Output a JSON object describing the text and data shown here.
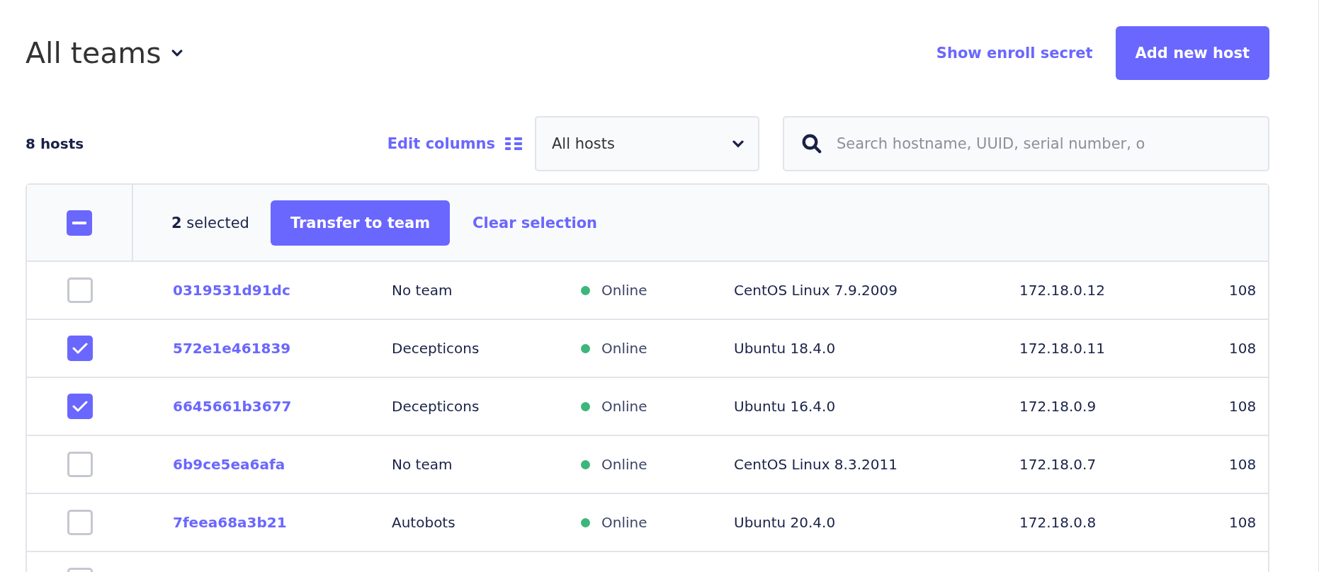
{
  "header": {
    "title": "All teams",
    "show_enroll_secret": "Show enroll secret",
    "add_button": "Add new host"
  },
  "toolbar": {
    "count": "8 hosts",
    "edit_columns": "Edit columns",
    "filter": {
      "value": "All hosts"
    },
    "search": {
      "placeholder": "Search hostname, UUID, serial number, o"
    }
  },
  "selection_bar": {
    "select_all": {
      "indeterminate": true
    },
    "selected_text": "**2** selected",
    "transfer_button": "Transfer to team",
    "clear_link": "Clear selection"
  },
  "table": {
    "rows": [
      {
        "checked": false,
        "hostname": "0319531d91dc",
        "team": "No team",
        "status": "Online",
        "os": "CentOS Linux 7.9.2009",
        "ip": "172.18.0.12",
        "column_7": "108"
      },
      {
        "checked": true,
        "hostname": "572e1e461839",
        "team": "Decepticons",
        "status": "Online",
        "os": "Ubuntu 18.4.0",
        "ip": "172.18.0.11",
        "column_7": "108"
      },
      {
        "checked": true,
        "hostname": "6645661b3677",
        "team": "Decepticons",
        "status": "Online",
        "os": "Ubuntu 16.4.0",
        "ip": "172.18.0.9",
        "column_7": "108"
      },
      {
        "checked": false,
        "hostname": "6b9ce5ea6afa",
        "team": "No team",
        "status": "Online",
        "os": "CentOS Linux 8.3.2011",
        "ip": "172.18.0.7",
        "column_7": "108"
      },
      {
        "checked": false,
        "hostname": "7feea68a3b21",
        "team": "Autobots",
        "status": "Online",
        "os": "Ubuntu 20.4.0",
        "ip": "172.18.0.8",
        "column_7": "108"
      },
      {
        "checked": false
      }
    ]
  }
}
